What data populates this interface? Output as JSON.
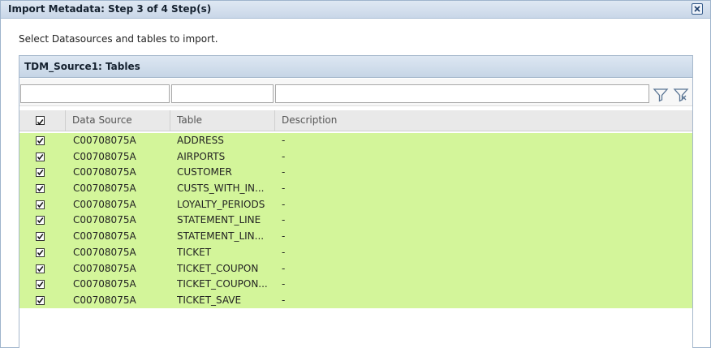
{
  "dialog": {
    "title": "Import Metadata: Step 3 of 4 Step(s)",
    "close_icon": "close-icon"
  },
  "instructions": "Select Datasources and tables to import.",
  "panel": {
    "title": "TDM_Source1: Tables",
    "filters": {
      "data_source": "",
      "table": "",
      "description": ""
    },
    "filter_icons": [
      "filter-icon",
      "clear-filter-icon"
    ],
    "columns": [
      "Data Source",
      "Table",
      "Description"
    ],
    "header_checked": true,
    "rows": [
      {
        "checked": true,
        "data_source": "C00708075A",
        "table": "ADDRESS",
        "description": "-"
      },
      {
        "checked": true,
        "data_source": "C00708075A",
        "table": "AIRPORTS",
        "description": "-"
      },
      {
        "checked": true,
        "data_source": "C00708075A",
        "table": "CUSTOMER",
        "description": "-"
      },
      {
        "checked": true,
        "data_source": "C00708075A",
        "table": "CUSTS_WITH_IN...",
        "description": "-"
      },
      {
        "checked": true,
        "data_source": "C00708075A",
        "table": "LOYALTY_PERIODS",
        "description": "-"
      },
      {
        "checked": true,
        "data_source": "C00708075A",
        "table": "STATEMENT_LINE",
        "description": "-"
      },
      {
        "checked": true,
        "data_source": "C00708075A",
        "table": "STATEMENT_LIN...",
        "description": "-"
      },
      {
        "checked": true,
        "data_source": "C00708075A",
        "table": "TICKET",
        "description": "-"
      },
      {
        "checked": true,
        "data_source": "C00708075A",
        "table": "TICKET_COUPON",
        "description": "-"
      },
      {
        "checked": true,
        "data_source": "C00708075A",
        "table": "TICKET_COUPON...",
        "description": "-"
      },
      {
        "checked": true,
        "data_source": "C00708075A",
        "table": "TICKET_SAVE",
        "description": "-"
      }
    ]
  },
  "colors": {
    "selected_row": "#d3f59a",
    "titlebar": "#c9d7e8"
  }
}
